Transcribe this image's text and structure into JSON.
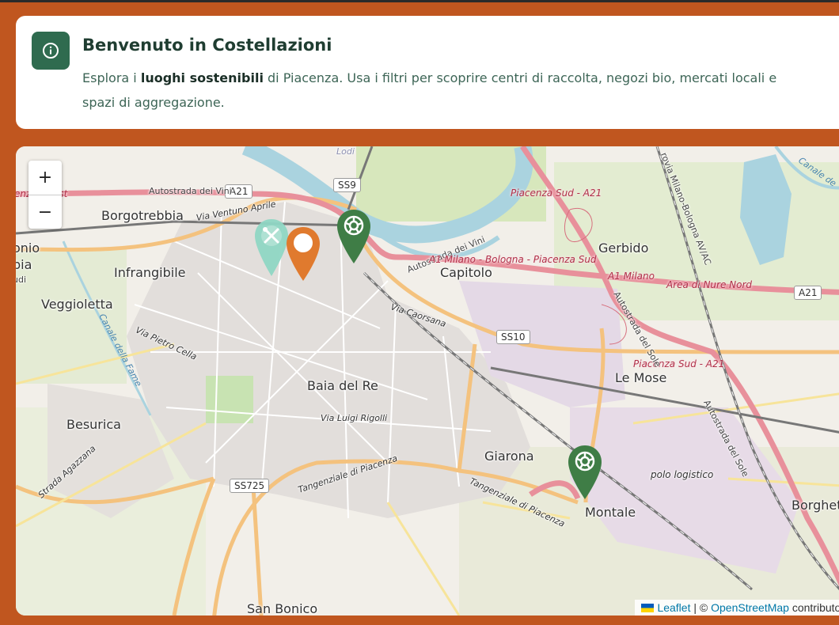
{
  "welcome": {
    "title": "Benvenuto in Costellazioni",
    "text_before": "Esplora i ",
    "text_bold": "luoghi sostenibili",
    "text_after": " di Piacenza. Usa i filtri per scoprire centri di raccolta, negozi bio, mercati locali e spazi di aggregazione.",
    "icon": "info-icon"
  },
  "map": {
    "zoom_in": "+",
    "zoom_out": "−",
    "places": {
      "borgotrebbia": "Borgotrebbia",
      "infrangibile": "Infrangibile",
      "veggioletta": "Veggioletta",
      "besurica": "Besurica",
      "baia_del_re": "Baia del Re",
      "capitolo": "Capitolo",
      "gerbido": "Gerbido",
      "le_mose": "Le Mose",
      "giarona": "Giarona",
      "montale": "Montale",
      "san_bonico": "San Bonico",
      "borghetto": "Borghett",
      "polo_logistico": "polo logistico",
      "lodi": "Lodi",
      "onio": "onio",
      "bia": "bia",
      "udi": "udi"
    },
    "roads": {
      "a21_west": "A21",
      "a21_east": "A21",
      "ss9": "SS9",
      "ss10": "SS10",
      "ss725": "SS725",
      "autostrada_vini": "Autostrada dei Vini",
      "piacenza_ovest": "enza Ovest",
      "piacenza_sud_a21": "Piacenza Sud - A21",
      "piacenza_sud_a21_2": "Piacenza Sud - A21",
      "autostrada_vini_2": "Autostrada dei Vini",
      "a1_milano_bologna": "A1 Milano - Bologna - Piacenza Sud",
      "a1_milano": "A1 Milano",
      "area_nure": "Area di Nure Nord",
      "autostrada_sole": "Autostrada del Sole",
      "autostrada_sole_2": "Autostrada del Sole",
      "via_caorsana": "Via Caorsana",
      "via_pietro_cella": "Via Pietro Cella",
      "via_luigi_rigolli": "Via Luigi Rigolli",
      "via_ventuno_aprile": "Via Ventuno Aprile",
      "tangenziale_1": "Tangenziale di Piacenza",
      "tangenziale_2": "Tangenziale di Piacenza",
      "strada_agazzana": "Strada Agazzana",
      "canale_fame": "Canale della Fame",
      "canale_east": "Canale de",
      "ferrovia": "rovia Milano-Bologna AV/AC"
    },
    "pins": [
      {
        "name": "tools",
        "color": "#8fd6c4",
        "icon": "tools-icon"
      },
      {
        "name": "market",
        "color": "#e07a2e",
        "icon": "circle-icon"
      },
      {
        "name": "recycle-1",
        "color": "#3f7d46",
        "icon": "recycle-icon"
      },
      {
        "name": "recycle-2",
        "color": "#3f7d46",
        "icon": "recycle-icon"
      }
    ],
    "attribution": {
      "leaflet": "Leaflet",
      "separator": " | © ",
      "osm": "OpenStreetMap",
      "contributors": " contributors"
    }
  },
  "colors": {
    "background": "#c0561f",
    "card": "#ffffff",
    "accent": "#2f6b4f",
    "motorway": "#e8909b",
    "trunk": "#f4c27e",
    "river": "#aad3df"
  }
}
